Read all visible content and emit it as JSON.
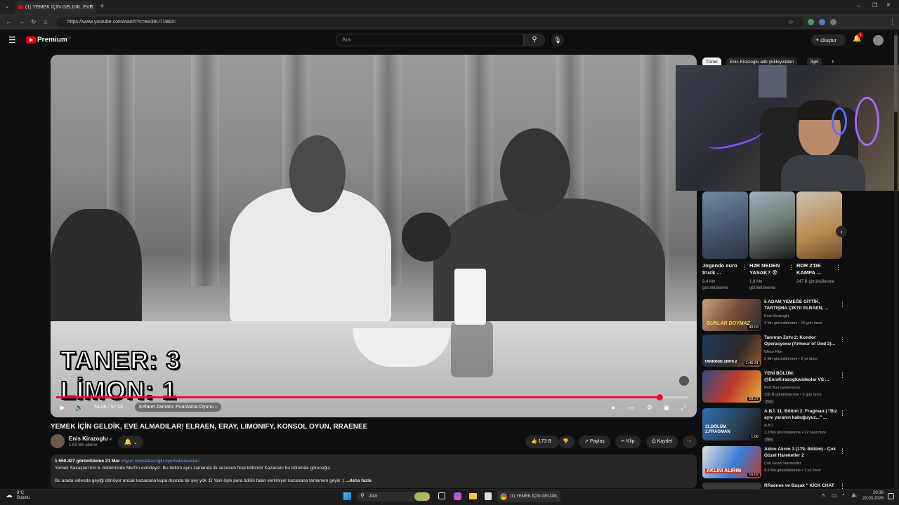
{
  "browser": {
    "tab_title": "(1) YEMEK İÇİN GELDİK, EVE",
    "url": "https://www.youtube.com/watch?v=ew39U71982c"
  },
  "header": {
    "logo_text": "Premium",
    "logo_sup": "TR",
    "search_placeholder": "Ara",
    "create_label": "Oluştur",
    "notifications_count": "1"
  },
  "player": {
    "overlay_line1": "TANER: 3",
    "overlay_line2": "LİMON: 1",
    "time": "54:36 / 57:13",
    "chapter": "Kefaret Zamanı: Puanlama Oyunu",
    "progress": 0.954
  },
  "video": {
    "title": "YEMEK İÇİN GELDİK, EVE ALMADILAR! ELRAEN, ERAY, LIMONIFY, KONSOL OYUN, RRAENEE",
    "channel": "Enis Kirazoglu",
    "subscribers": "1,63 Mn abone",
    "likes": "173 B",
    "share": "Paylaş",
    "clip": "Klip",
    "save": "Kaydet",
    "views_date": "1.550.427 görüntüleme  21 Mar",
    "tags": "#oyun #eniskirazoglu #yemeksavasları",
    "desc_line1": "Yemek Savaşları'nın 5. bölümünde Mert'in evindeyiz. Bu bölüm aynı zamanda ilk sezonun final bölümü! Kazananı bu bölümde göreceğiz.",
    "desc_line2": "Bu arada videoda geyiği dönüyor ancak kazanana kupa dışında bir şey yok :D Yani öyle para ödülü falan verilmiyor kazanana tamamen geyik :)",
    "more": "...daha fazla"
  },
  "chips": [
    "Tümü",
    "Enis Kirazoglu adlı yükleyiciden",
    "İlgili"
  ],
  "shorts": [
    {
      "title": "Jogando euro truck ...",
      "views": "9,4 Mn görüntülenme"
    },
    {
      "title": "H2R NEDEN YASAK? 😨",
      "views": "1,8 Mn görüntülenme"
    },
    {
      "title": "RDR 2'DE KAMPA ...",
      "views": "247 B görüntülenme"
    }
  ],
  "recommendations": [
    {
      "title": "5 ADAM YEMEĞE GİTTİK, TARTIŞMA ÇIKTI! ELRAEN, ...",
      "channel": "Enis Kirazoglu",
      "meta": "2 Mn görüntülenme • 10 gün önce",
      "duration": "40:03",
      "badge": "",
      "thumb_text": "BUNLAR DOYMAZ"
    },
    {
      "title": "Tanrının Zırhı 2: Kondor Operasyonu (Armour of God 2)...",
      "channel": "Weco Film",
      "meta": "2 Mn görüntülenme • 2 yıl önce",
      "duration": "1:46:31",
      "badge": "",
      "thumb_text": "TANRININ ZIRHI 2"
    },
    {
      "title": "YENİ BÖLÜM: @EnisKirazogluvideolar VS ...",
      "channel": "Red Bull Gamerszon",
      "meta": "138 B görüntülenme • 2 gün önce",
      "duration": "28:27",
      "badge": "Yeni",
      "thumb_text": ""
    },
    {
      "title": "A.B.İ. 11. Bölüm 2. Fragman | \"Biz aynı yaranın kabuğuyuz...\" ...",
      "channel": "A.B.İ.",
      "meta": "2,2 Mn görüntülenme • 22 saat önce",
      "duration": "1:06",
      "badge": "Yeni",
      "thumb_text": "11.BÖLÜM 2.FRAGMAN"
    },
    {
      "title": "Aklını Alırım 3 (179. Bölüm) - Çok Güzel Hareketler 2",
      "channel": "Çok Güzel Hareketler",
      "meta": "8,5 Mn görüntülenme • 1 yıl önce",
      "duration": "16:02",
      "badge": "",
      "thumb_text": "AKLINI ALIRIM"
    },
    {
      "title": "RRaenee ve Başak \" KİCK CHAT",
      "channel": "",
      "meta": "",
      "duration": "",
      "badge": "",
      "thumb_text": ""
    }
  ],
  "taskbar": {
    "weather_temp": "8°C",
    "weather_desc": "Bulutlu",
    "search": "Ara",
    "chrome_label": "(1) YEMEK İÇİN GELDİK,",
    "time": "20:36",
    "date": "22.03.2026"
  }
}
